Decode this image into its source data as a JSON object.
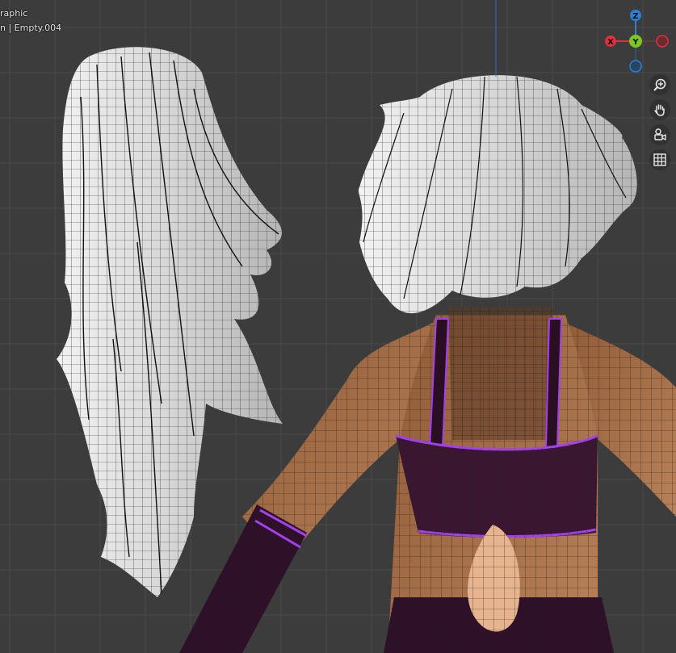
{
  "viewport": {
    "view_mode": "raphic",
    "view_info": "n | Empty.004"
  },
  "gizmo": {
    "axes": [
      {
        "name": "Z",
        "color": "#2c7fd4"
      },
      {
        "name": "Y",
        "color": "#7ec624"
      },
      {
        "name": "X",
        "color": "#e0303c"
      }
    ]
  },
  "tools": [
    {
      "name": "zoom-icon"
    },
    {
      "name": "hand-icon"
    },
    {
      "name": "camera-icon"
    },
    {
      "name": "grid-icon"
    }
  ],
  "colors": {
    "background": "#3c3c3c",
    "grid_line": "#4a4a4a",
    "hair": "#dcdcdc",
    "skin": "#a26d48",
    "cloth": "#3a1630",
    "accent": "#a340f0"
  }
}
